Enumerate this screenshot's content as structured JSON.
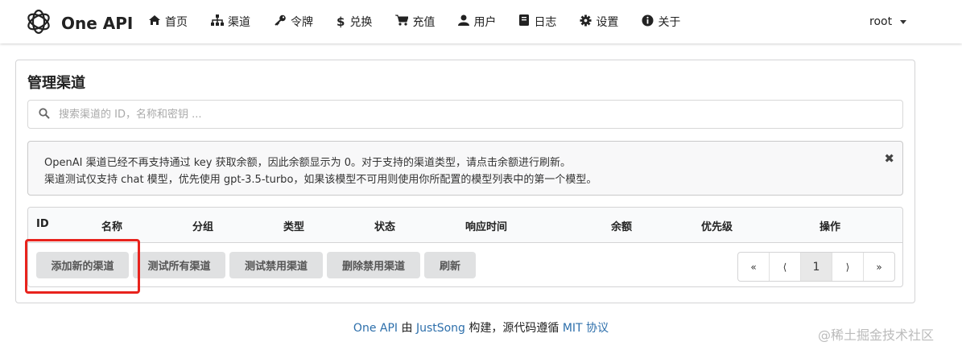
{
  "nav": {
    "brand": "One API",
    "items": [
      {
        "label": "首页",
        "icon": "home-icon"
      },
      {
        "label": "渠道",
        "icon": "sitemap-icon"
      },
      {
        "label": "令牌",
        "icon": "key-icon"
      },
      {
        "label": "兑换",
        "icon": "dollar-icon"
      },
      {
        "label": "充值",
        "icon": "cart-icon"
      },
      {
        "label": "用户",
        "icon": "user-icon"
      },
      {
        "label": "日志",
        "icon": "book-icon"
      },
      {
        "label": "设置",
        "icon": "gear-icon"
      },
      {
        "label": "关于",
        "icon": "info-icon"
      }
    ],
    "user": "root"
  },
  "card": {
    "title": "管理渠道",
    "search_placeholder": "搜索渠道的 ID，名称和密钥 ...",
    "notice": {
      "line1": "OpenAI 渠道已经不再支持通过 key 获取余额，因此余额显示为 0。对于支持的渠道类型，请点击余额进行刷新。",
      "line2": "渠道测试仅支持 chat 模型，优先使用 gpt-3.5-turbo，如果该模型不可用则使用你所配置的模型列表中的第一个模型。",
      "close": "✖"
    },
    "table": {
      "columns": [
        "ID",
        "名称",
        "分组",
        "类型",
        "状态",
        "响应时间",
        "余额",
        "优先级",
        "操作"
      ]
    },
    "buttons": {
      "add": "添加新的渠道",
      "test_all": "测试所有渠道",
      "test_disabled": "测试禁用渠道",
      "delete_disabled": "删除禁用渠道",
      "refresh": "刷新"
    },
    "pagination": {
      "first": "«",
      "prev": "⟨",
      "current": "1",
      "next": "⟩",
      "last": "»"
    }
  },
  "footer": {
    "brand_link": "One API",
    "by": " 由 ",
    "author_link": "JustSong",
    "build": " 构建，源代码遵循 ",
    "license_link": "MIT 协议"
  },
  "watermark": "@稀土掘金技术社区",
  "colors": {
    "accent_link": "#2d6fab",
    "highlight_border": "#e8231d",
    "button_bg": "#e0e1e2"
  }
}
